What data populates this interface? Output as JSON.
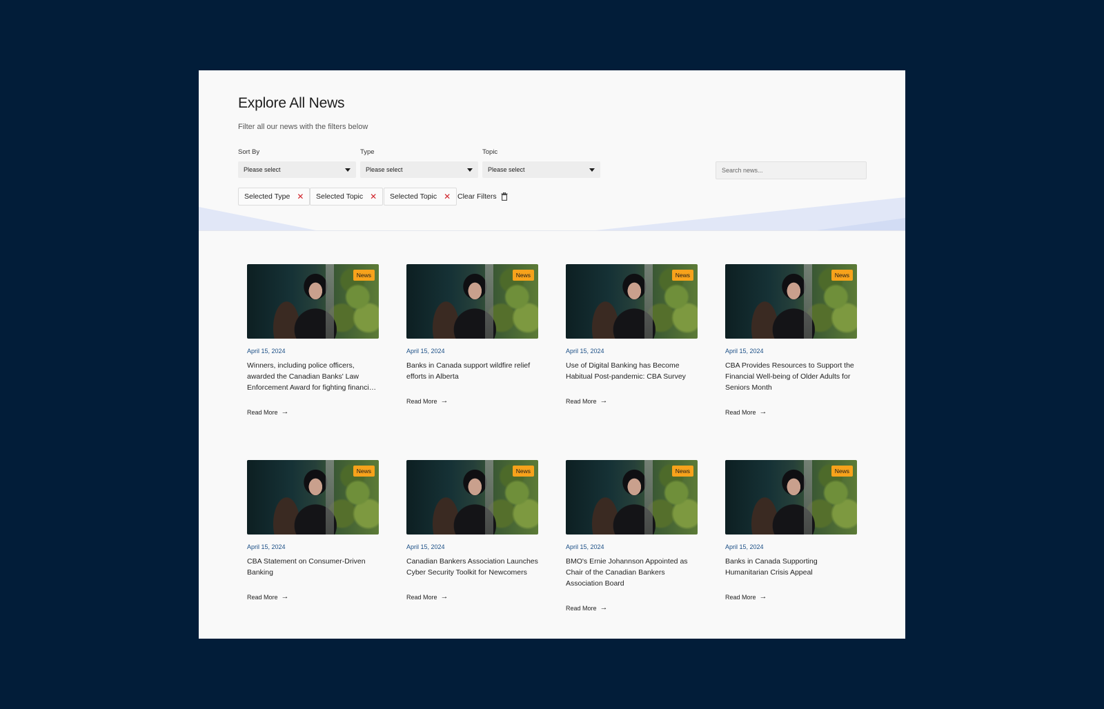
{
  "header": {
    "title": "Explore All News",
    "subtitle": "Filter all our news with the filters below"
  },
  "filters": {
    "sort_by": {
      "label": "Sort By",
      "value": "Please select"
    },
    "type": {
      "label": "Type",
      "value": "Please select"
    },
    "topic": {
      "label": "Topic",
      "value": "Please select"
    },
    "search_placeholder": "Search news..."
  },
  "chips": [
    "Selected Type",
    "Selected Topic",
    "Selected Topic"
  ],
  "clear_filters_label": "Clear Filters",
  "colors": {
    "page_background": "#021d39",
    "badge": "#f7a21b",
    "date": "#1b4f86",
    "chip_remove": "#d0232a"
  },
  "icons": {
    "chip_remove": "close-icon",
    "clear_filters": "trash-icon",
    "dropdown": "caret-down-icon",
    "read_more": "arrow-right-icon"
  },
  "cards": [
    {
      "badge": "News",
      "date": "April 15, 2024",
      "title": "Winners, including police officers, awarded the Canadian Banks' Law Enforcement Award for fighting financial crime",
      "read_more": "Read More"
    },
    {
      "badge": "News",
      "date": "April 15, 2024",
      "title": "Banks in Canada support wildfire relief efforts in Alberta",
      "read_more": "Read More"
    },
    {
      "badge": "News",
      "date": "April 15, 2024",
      "title": "Use of Digital Banking has Become Habitual Post-pandemic: CBA Survey",
      "read_more": "Read More"
    },
    {
      "badge": "News",
      "date": "April 15, 2024",
      "title": "CBA Provides Resources to Support the Financial Well-being of Older Adults for Seniors Month",
      "read_more": "Read More"
    },
    {
      "badge": "News",
      "date": "April 15, 2024",
      "title": "CBA Statement on Consumer-Driven Banking",
      "read_more": "Read More"
    },
    {
      "badge": "News",
      "date": "April 15, 2024",
      "title": "Canadian Bankers Association Launches Cyber Security Toolkit for Newcomers",
      "read_more": "Read More"
    },
    {
      "badge": "News",
      "date": "April 15, 2024",
      "title": "BMO's Ernie Johannson Appointed as Chair of the Canadian Bankers Association Board",
      "read_more": "Read More"
    },
    {
      "badge": "News",
      "date": "April 15, 2024",
      "title": "Banks in Canada Supporting Humanitarian Crisis Appeal",
      "read_more": "Read More"
    }
  ]
}
